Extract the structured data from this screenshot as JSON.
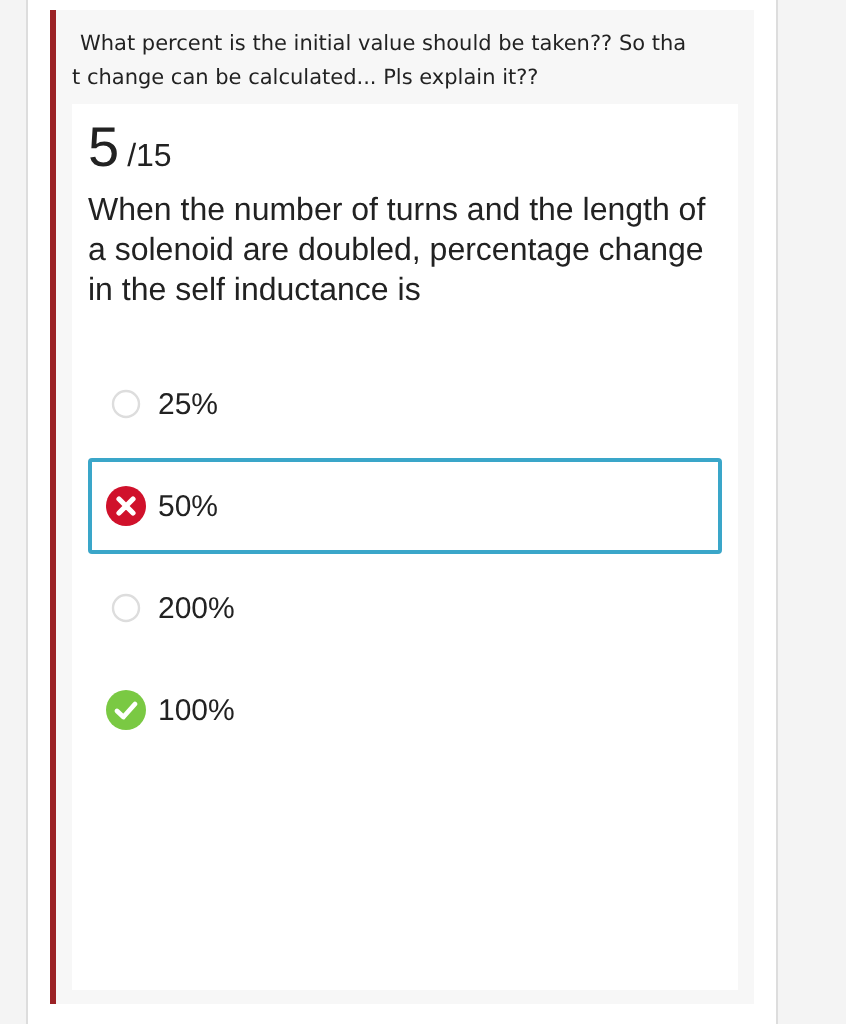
{
  "comment_lines": [
    "What percent is the initial value should be taken?? So tha",
    "t change can be calculated... Pls explain it??"
  ],
  "score": {
    "points": "5",
    "total": "/15"
  },
  "question": "When the number of turns and the length of a solenoid are doubled, percentage change in the self inductance is",
  "options": [
    {
      "label": "25%",
      "kind": "unanswered",
      "selected": false
    },
    {
      "label": "50%",
      "kind": "wrong",
      "selected": true
    },
    {
      "label": "200%",
      "kind": "unanswered",
      "selected": false
    },
    {
      "label": "100%",
      "kind": "correct",
      "selected": false
    }
  ]
}
